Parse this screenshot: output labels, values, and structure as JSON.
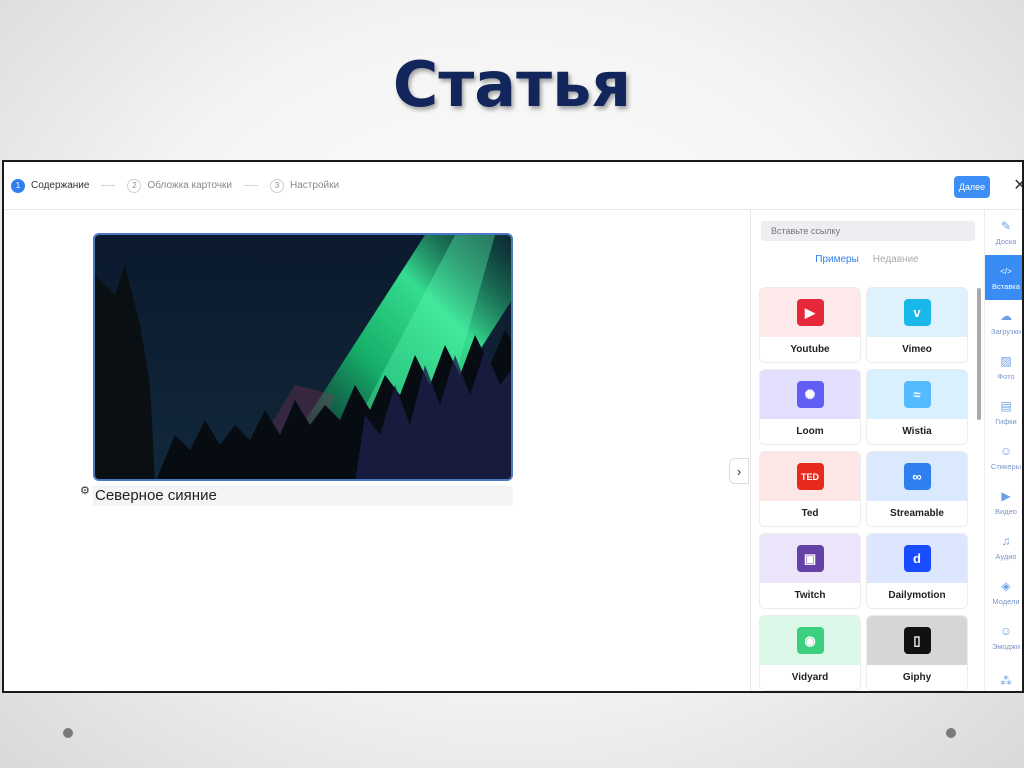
{
  "slide": {
    "title": "Статья"
  },
  "steps": [
    {
      "num": "1",
      "label": "Содержание",
      "active": true
    },
    {
      "num": "2",
      "label": "Обложка карточки",
      "active": false
    },
    {
      "num": "3",
      "label": "Настройки",
      "active": false
    }
  ],
  "topbar": {
    "next_label": "Далее",
    "close_glyph": "✕"
  },
  "editor": {
    "caption": "Северное сияние",
    "gear_glyph": "⚙",
    "collapse_glyph": "›"
  },
  "panel": {
    "link_placeholder": "Вставьте ссылку",
    "tabs": {
      "examples": "Примеры",
      "recent": "Недавние"
    },
    "cards": [
      {
        "label": "Youtube",
        "icon": "youtube-icon",
        "bg": "#fde9ea",
        "logo_bg": "#e6283a",
        "glyph": "▶"
      },
      {
        "label": "Vimeo",
        "icon": "vimeo-icon",
        "bg": "#dff1fb",
        "logo_bg": "#1ab7ea",
        "glyph": "v"
      },
      {
        "label": "Loom",
        "icon": "loom-icon",
        "bg": "#e3e0ff",
        "logo_bg": "#625df5",
        "glyph": "✺"
      },
      {
        "label": "Wistia",
        "icon": "wistia-icon",
        "bg": "#d9f1ff",
        "logo_bg": "#54bbff",
        "glyph": "≈"
      },
      {
        "label": "Ted",
        "icon": "ted-icon",
        "bg": "#fde6e6",
        "logo_bg": "#e62b1e",
        "glyph": "TED"
      },
      {
        "label": "Streamable",
        "icon": "streamable-icon",
        "bg": "#dbe9ff",
        "logo_bg": "#2f7ff0",
        "glyph": "∞"
      },
      {
        "label": "Twitch",
        "icon": "twitch-icon",
        "bg": "#ece4fb",
        "logo_bg": "#6441a5",
        "glyph": "▣"
      },
      {
        "label": "Dailymotion",
        "icon": "dailymotion-icon",
        "bg": "#dde6ff",
        "logo_bg": "#1a4cff",
        "glyph": "d"
      },
      {
        "label": "Vidyard",
        "icon": "vidyard-icon",
        "bg": "#dcf8e8",
        "logo_bg": "#3ccf7e",
        "glyph": "◉"
      },
      {
        "label": "Giphy",
        "icon": "giphy-icon",
        "bg": "#d6d6d6",
        "logo_bg": "#111111",
        "glyph": "▯"
      }
    ]
  },
  "rail": [
    {
      "label": "Доска",
      "icon": "brush-icon",
      "glyph": "✎",
      "active": false
    },
    {
      "label": "Вставка",
      "icon": "code-icon",
      "glyph": "</>",
      "active": true
    },
    {
      "label": "Загрузки",
      "icon": "cloud-upload-icon",
      "glyph": "☁",
      "active": false
    },
    {
      "label": "Фото",
      "icon": "photo-icon",
      "glyph": "▨",
      "active": false
    },
    {
      "label": "Гифки",
      "icon": "gif-icon",
      "glyph": "▤",
      "active": false
    },
    {
      "label": "Стикеры",
      "icon": "sticker-icon",
      "glyph": "☺",
      "active": false
    },
    {
      "label": "Видео",
      "icon": "video-icon",
      "glyph": "▶",
      "active": false
    },
    {
      "label": "Аудио",
      "icon": "music-icon",
      "glyph": "♫",
      "active": false
    },
    {
      "label": "Модели",
      "icon": "cube-icon",
      "glyph": "◈",
      "active": false
    },
    {
      "label": "Эмоджи",
      "icon": "emoji-icon",
      "glyph": "☺",
      "active": false
    },
    {
      "label": "",
      "icon": "gamepad-icon",
      "glyph": "⁂",
      "active": false
    }
  ]
}
